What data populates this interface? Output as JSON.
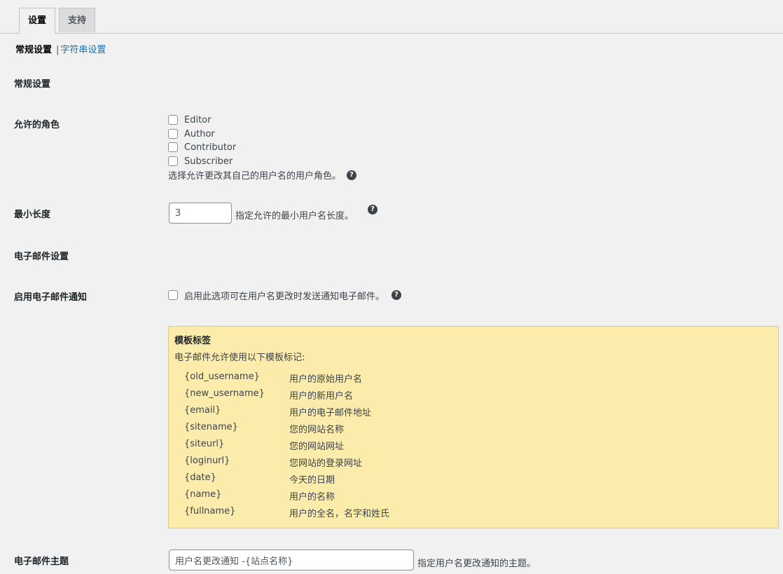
{
  "tabs": [
    {
      "label": "设置",
      "active": true
    },
    {
      "label": "支持",
      "active": false
    }
  ],
  "subnav": {
    "current": "常规设置",
    "separator": "|",
    "link": "字符串设置"
  },
  "sections": {
    "general": "常规设置",
    "email": "电子邮件设置"
  },
  "roles": {
    "label": "允许的角色",
    "options": [
      "Editor",
      "Author",
      "Contributor",
      "Subscriber"
    ],
    "description": "选择允许更改其自己的用户名的用户角色。"
  },
  "min_length": {
    "label": "最小长度",
    "value": "3",
    "description": "指定允许的最小用户名长度。"
  },
  "email_notify": {
    "label": "启用电子邮件通知",
    "checkbox_text": "启用此选项可在用户名更改时发送通知电子邮件。"
  },
  "template_tags": {
    "title": "模板标签",
    "intro": "电子邮件允许使用以下模板标记:",
    "rows": [
      {
        "tag": "{old_username}",
        "desc": "用户的原始用户名"
      },
      {
        "tag": "{new_username}",
        "desc": "用户的新用户名"
      },
      {
        "tag": "{email}",
        "desc": "用户的电子邮件地址"
      },
      {
        "tag": "{sitename}",
        "desc": "您的网站名称"
      },
      {
        "tag": "{siteurl}",
        "desc": "您的网站网址"
      },
      {
        "tag": "{loginurl}",
        "desc": "您网站的登录网址"
      },
      {
        "tag": "{date}",
        "desc": "今天的日期"
      },
      {
        "tag": "{name}",
        "desc": "用户的名称"
      },
      {
        "tag": "{fullname}",
        "desc": "用户的全名，名字和姓氏"
      }
    ]
  },
  "email_subject": {
    "label": "电子邮件主题",
    "value": "用户名更改通知 -{站点名称}",
    "description": "指定用户名更改通知的主题。"
  },
  "help_icon": "help-icon",
  "colors": {
    "link": "#2271b1",
    "template_bg": "#fcecac",
    "page_bg": "#f1f1f1"
  }
}
